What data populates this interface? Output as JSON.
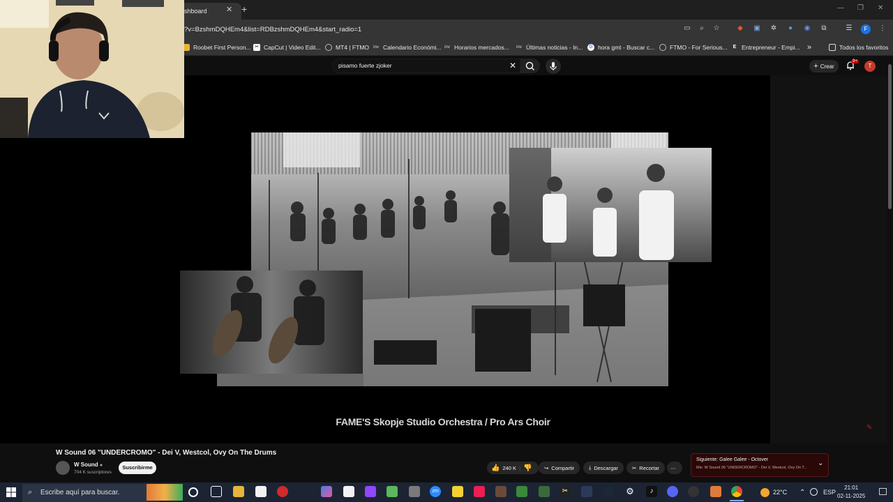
{
  "browser": {
    "tab_title": "shboard",
    "url": "?v=BzshmDQHEm4&list=RDBzshmDQHEm4&start_radio=1",
    "bookmarks": [
      {
        "label": "Roobet First Person...",
        "icon": "roobet-icon",
        "color": "#e8b13a"
      },
      {
        "label": "CapCut | Video Edit...",
        "icon": "capcut-icon",
        "color": "#ffffff"
      },
      {
        "label": "MT4 | FTMO",
        "icon": "globe-icon",
        "color": "#bbbbbb"
      },
      {
        "label": "Calendario Económi...",
        "icon": "investing-icon",
        "color": "#dddddd"
      },
      {
        "label": "Horarios mercados...",
        "icon": "investing-icon",
        "color": "#dddddd"
      },
      {
        "label": "Últimas noticias - In...",
        "icon": "investing-icon",
        "color": "#dddddd"
      },
      {
        "label": "hora gmt - Buscar c...",
        "icon": "google-icon",
        "color": "#ffffff"
      },
      {
        "label": "FTMO - For Serious...",
        "icon": "ftmo-icon",
        "color": "#bbbbbb"
      },
      {
        "label": "Entrepreneur - Empi...",
        "icon": "entrepreneur-icon",
        "color": "#ffffff"
      }
    ],
    "all_bookmarks_label": "Todos los favoritos"
  },
  "youtube": {
    "search_value": "pisamo fuerte zjoker",
    "create_label": "Crear",
    "notifications_count": "9+",
    "avatar_letter": "T",
    "video_caption": "FAME'S Skopje Studio Orchestra / Pro Ars Choir",
    "video_title": "W Sound 06 \"UNDERCROMO\" - Dei V, Westcol, Ovy On The Drums",
    "channel_name": "W Sound",
    "subscribers": "704 K suscriptores",
    "subscribe_label": "Suscribirme",
    "likes": "240 K",
    "share_label": "Compartir",
    "download_label": "Descargar",
    "clip_label": "Recortar",
    "next_title": "Siguiente: Galee Galee - Octover",
    "next_sub": "Mix: W Sound 06 \"UNDERCROMO\" - Dei V, Westcol, Ovy On T..."
  },
  "taskbar": {
    "search_placeholder": "Escribe aquí para buscar.",
    "weather": "22°C",
    "language": "ESP",
    "time": "21:01",
    "date": "02-11-2025"
  },
  "colors": {
    "youtube_red": "#cc0000",
    "avatar_red": "#c53929",
    "taskbar": "#1c2433"
  }
}
